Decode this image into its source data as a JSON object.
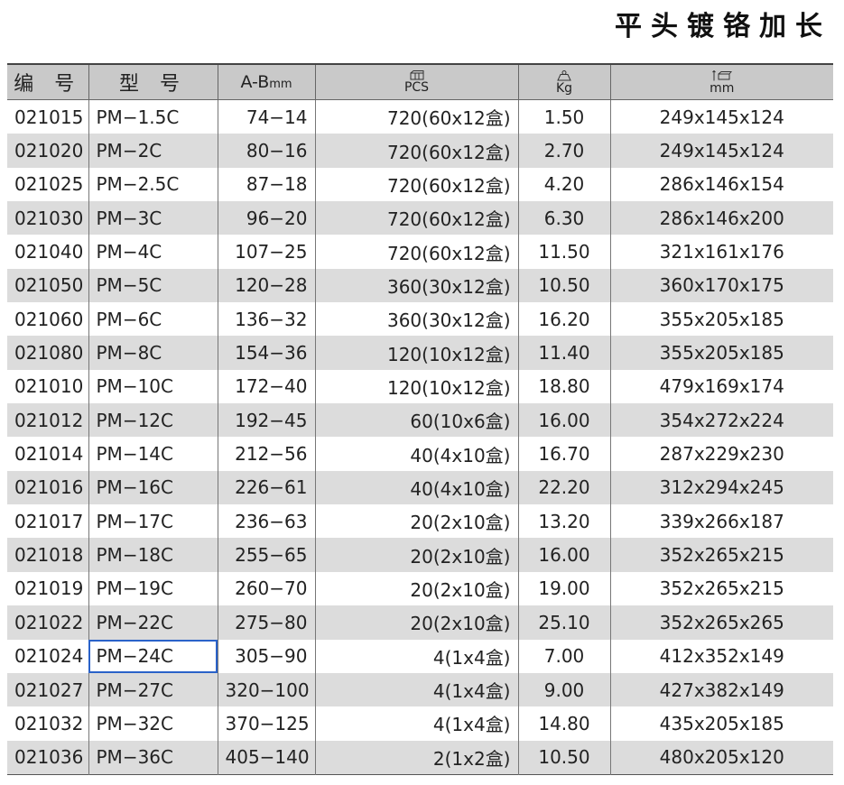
{
  "title": "平头镀铬加长",
  "headers": {
    "code": "编 号",
    "model": "型 号",
    "ab": "A-B",
    "ab_unit": "mm",
    "pcs": "PCS",
    "kg": "Kg",
    "dim": "mm",
    "pcs_icon": "box-icon",
    "kg_icon": "weight-icon",
    "dim_icon": "carton-dimension-icon"
  },
  "selected_row": 16,
  "rows": [
    {
      "code": "021015",
      "model": "PM−1.5C",
      "ab": "74−14",
      "pcs": "720(60x12盒)",
      "kg": "1.50",
      "dim": "249x145x124"
    },
    {
      "code": "021020",
      "model": "PM−2C",
      "ab": "80−16",
      "pcs": "720(60x12盒)",
      "kg": "2.70",
      "dim": "249x145x124"
    },
    {
      "code": "021025",
      "model": "PM−2.5C",
      "ab": "87−18",
      "pcs": "720(60x12盒)",
      "kg": "4.20",
      "dim": "286x146x154"
    },
    {
      "code": "021030",
      "model": "PM−3C",
      "ab": "96−20",
      "pcs": "720(60x12盒)",
      "kg": "6.30",
      "dim": "286x146x200"
    },
    {
      "code": "021040",
      "model": "PM−4C",
      "ab": "107−25",
      "pcs": "720(60x12盒)",
      "kg": "11.50",
      "dim": "321x161x176"
    },
    {
      "code": "021050",
      "model": "PM−5C",
      "ab": "120−28",
      "pcs": "360(30x12盒)",
      "kg": "10.50",
      "dim": "360x170x175"
    },
    {
      "code": "021060",
      "model": "PM−6C",
      "ab": "136−32",
      "pcs": "360(30x12盒)",
      "kg": "16.20",
      "dim": "355x205x185"
    },
    {
      "code": "021080",
      "model": "PM−8C",
      "ab": "154−36",
      "pcs": "120(10x12盒)",
      "kg": "11.40",
      "dim": "355x205x185"
    },
    {
      "code": "021010",
      "model": "PM−10C",
      "ab": "172−40",
      "pcs": "120(10x12盒)",
      "kg": "18.80",
      "dim": "479x169x174"
    },
    {
      "code": "021012",
      "model": "PM−12C",
      "ab": "192−45",
      "pcs": "60(10x6盒)",
      "kg": "16.00",
      "dim": "354x272x224"
    },
    {
      "code": "021014",
      "model": "PM−14C",
      "ab": "212−56",
      "pcs": "40(4x10盒)",
      "kg": "16.70",
      "dim": "287x229x230"
    },
    {
      "code": "021016",
      "model": "PM−16C",
      "ab": "226−61",
      "pcs": "40(4x10盒)",
      "kg": "22.20",
      "dim": "312x294x245"
    },
    {
      "code": "021017",
      "model": "PM−17C",
      "ab": "236−63",
      "pcs": "20(2x10盒)",
      "kg": "13.20",
      "dim": "339x266x187"
    },
    {
      "code": "021018",
      "model": "PM−18C",
      "ab": "255−65",
      "pcs": "20(2x10盒)",
      "kg": "16.00",
      "dim": "352x265x215"
    },
    {
      "code": "021019",
      "model": "PM−19C",
      "ab": "260−70",
      "pcs": "20(2x10盒)",
      "kg": "19.00",
      "dim": "352x265x215"
    },
    {
      "code": "021022",
      "model": "PM−22C",
      "ab": "275−80",
      "pcs": "20(2x10盒)",
      "kg": "25.10",
      "dim": "352x265x265"
    },
    {
      "code": "021024",
      "model": "PM−24C",
      "ab": "305−90",
      "pcs": "4(1x4盒)",
      "kg": "7.00",
      "dim": "412x352x149"
    },
    {
      "code": "021027",
      "model": "PM−27C",
      "ab": "320−100",
      "pcs": "4(1x4盒)",
      "kg": "9.00",
      "dim": "427x382x149"
    },
    {
      "code": "021032",
      "model": "PM−32C",
      "ab": "370−125",
      "pcs": "4(1x4盒)",
      "kg": "14.80",
      "dim": "435x205x185"
    },
    {
      "code": "021036",
      "model": "PM−36C",
      "ab": "405−140",
      "pcs": "2(1x2盒)",
      "kg": "10.50",
      "dim": "480x205x120"
    }
  ]
}
